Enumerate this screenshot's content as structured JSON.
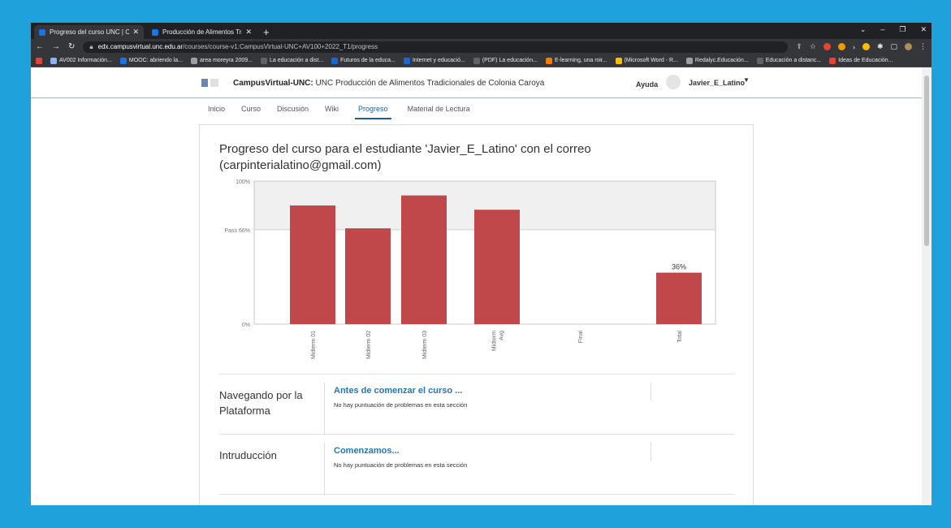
{
  "browser": {
    "tabs": [
      {
        "title": "Progreso del curso UNC | Campu",
        "active": true
      },
      {
        "title": "Producción de Alimentos Tradici",
        "active": false
      }
    ],
    "url_host": "edx.campusvirtual.unc.edu.ar",
    "url_path": "/courses/course-v1:CampusVirtual-UNC+AV100+2022_T1/progress",
    "bookmarks": [
      "AV002 Información...",
      "MOOC: abriendo la...",
      "area moreyra 2009...",
      "La educación a dist...",
      "Futuros de la educa...",
      "Internet y educació...",
      "(PDF) La educación...",
      "E-learning, una mir...",
      "(Microsoft Word - R...",
      "Redalyc.Educación...",
      "Educación a distanc...",
      "Ideas de Educación..."
    ]
  },
  "header": {
    "site_name": "CampusVirtual-UNC:",
    "course_name": "UNC Producción de Alimentos Tradicionales de Colonia Caroya",
    "help": "Ayuda",
    "username": "Javier_E_Latino"
  },
  "nav": {
    "tabs": [
      "Inicio",
      "Curso",
      "Discusión",
      "Wiki",
      "Progreso",
      "Material de Lectura"
    ],
    "active": "Progreso"
  },
  "progress": {
    "title": "Progreso del curso para el estudiante 'Javier_E_Latino' con el correo (carpinterialatino@gmail.com)"
  },
  "chart_data": {
    "type": "bar",
    "categories": [
      "Midterm 01",
      "Midterm 02",
      "Midterm 03",
      "Midterm Avg",
      "Final",
      "Total"
    ],
    "values": [
      83,
      67,
      90,
      80,
      0,
      36
    ],
    "data_labels": [
      "",
      "",
      "",
      "",
      "",
      "36%"
    ],
    "yticks": [
      "100%",
      "Pass 66%",
      "0%"
    ],
    "pass_value": 66,
    "ylim": [
      0,
      100
    ],
    "bar_color": "#c0474a"
  },
  "sections": [
    {
      "name": "Navegando por la Plataforma",
      "subsection": "Antes de comenzar el curso ...",
      "note": "No hay puntuación de problemas en esta sección"
    },
    {
      "name": "Intruducción",
      "subsection": "Comenzamos...",
      "note": "No hay puntuación de problemas en esta sección"
    }
  ]
}
